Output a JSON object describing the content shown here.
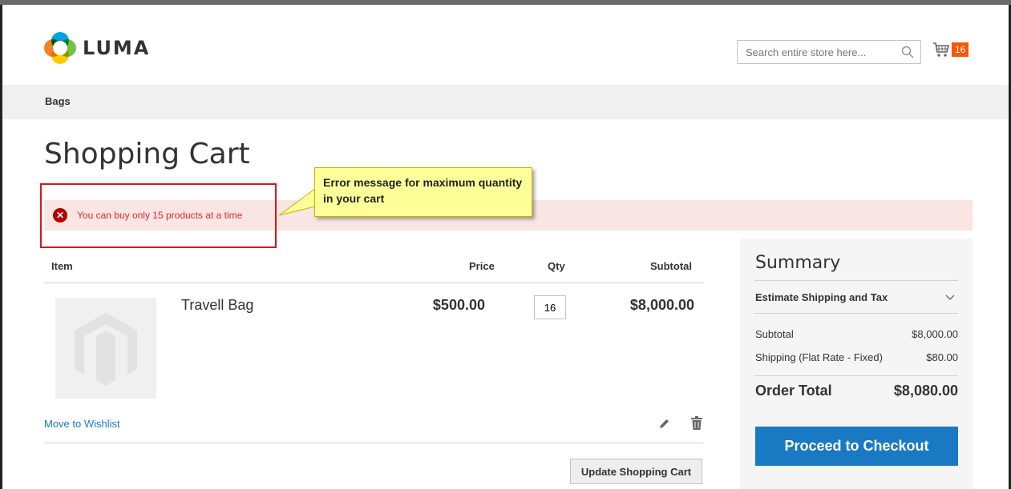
{
  "header": {
    "brand": "LUMA",
    "search_placeholder": "Search entire store here...",
    "cart_count": "16"
  },
  "nav": {
    "category": "Bags"
  },
  "page_title": "Shopping Cart",
  "message": {
    "error": "You can buy only 15 products at a time"
  },
  "annotation": {
    "callout": "Error message for maximum quantity in your cart"
  },
  "cart": {
    "columns": {
      "item": "Item",
      "price": "Price",
      "qty": "Qty",
      "subtotal": "Subtotal"
    },
    "items": [
      {
        "name": "Travell Bag",
        "price": "$500.00",
        "qty": "16",
        "subtotal": "$8,000.00"
      }
    ],
    "move_to_wishlist": "Move to Wishlist",
    "update_button": "Update Shopping Cart"
  },
  "summary": {
    "title": "Summary",
    "estimate_label": "Estimate Shipping and Tax",
    "subtotal_label": "Subtotal",
    "subtotal_value": "$8,000.00",
    "shipping_label": "Shipping (Flat Rate - Fixed)",
    "shipping_value": "$80.00",
    "total_label": "Order Total",
    "total_value": "$8,080.00",
    "checkout_button": "Proceed to Checkout"
  },
  "colors": {
    "accent": "#1979c3",
    "error": "#e02b27",
    "badge": "#ff5501",
    "callout": "#ffff99",
    "highlight": "#d11a1a"
  }
}
